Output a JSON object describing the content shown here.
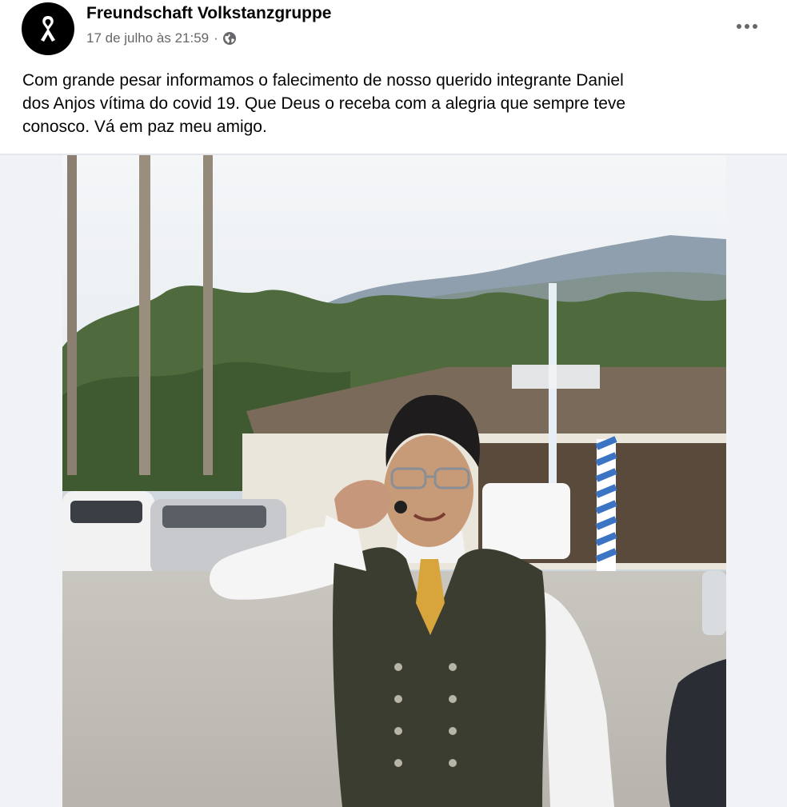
{
  "post": {
    "page_name": "Freundschaft Volkstanzgruppe",
    "timestamp": "17 de julho às 21:59",
    "separator": "·",
    "audience_icon": "globe-icon",
    "avatar_icon": "black-ribbon-icon",
    "more_icon": "more-options-icon",
    "text_lines": [
      "Com grande pesar informamos o falecimento de nosso querido integrante Daniel",
      "dos Anjos vítima do covid  19. Que Deus o receba com a alegria que sempre teve",
      "conosco. Vá em paz meu amigo."
    ]
  },
  "colors": {
    "background": "#ffffff",
    "text": "#050505",
    "secondary_text": "#65676b",
    "media_background": "#f0f2f5"
  }
}
